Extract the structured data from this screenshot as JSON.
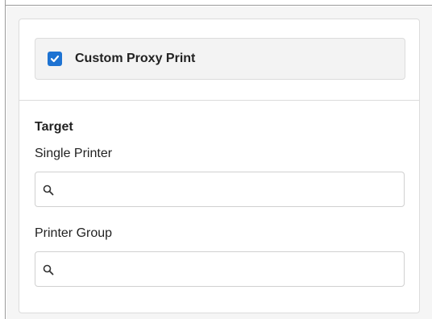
{
  "header": {
    "label": "Custom Proxy Print",
    "checked": true,
    "checkbox_color": "#1e73d2",
    "icon": "checkmark-icon"
  },
  "target": {
    "title": "Target",
    "single_printer": {
      "label": "Single Printer",
      "value": "",
      "placeholder": "",
      "icon": "search-icon"
    },
    "printer_group": {
      "label": "Printer Group",
      "value": "",
      "placeholder": "",
      "icon": "search-icon"
    }
  }
}
